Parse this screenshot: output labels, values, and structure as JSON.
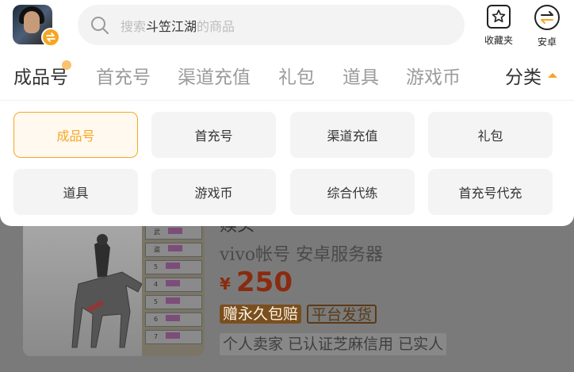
{
  "header": {
    "search_prefix": "搜索",
    "search_game": "斗笠江湖",
    "search_suffix": "的商品",
    "favorites_label": "收藏夹",
    "platform_label": "安卓"
  },
  "tabs": [
    {
      "label": "成品号"
    },
    {
      "label": "首充号"
    },
    {
      "label": "渠道充值"
    },
    {
      "label": "礼包"
    },
    {
      "label": "道具"
    },
    {
      "label": "游戏币"
    }
  ],
  "category_label": "分类",
  "category_grid": [
    {
      "label": "成品号"
    },
    {
      "label": "首充号"
    },
    {
      "label": "渠道充值"
    },
    {
      "label": "礼包"
    },
    {
      "label": "道具"
    },
    {
      "label": "游戏币"
    },
    {
      "label": "综合代练"
    },
    {
      "label": "首充号代充"
    }
  ],
  "listing": {
    "title": "赎头",
    "subtitle": "vivo帐号 安卓服务器",
    "currency": "¥",
    "price": "250",
    "badge_primary": "赠永久包赔",
    "badge_secondary": "平台发货",
    "description": "个人卖家 已认证芝麻信用 已实人",
    "table_rows": [
      "武",
      "盗",
      "5",
      "4",
      "5",
      "6",
      "7"
    ]
  },
  "colors": {
    "accent": "#f6a623",
    "price": "#c0391b"
  }
}
